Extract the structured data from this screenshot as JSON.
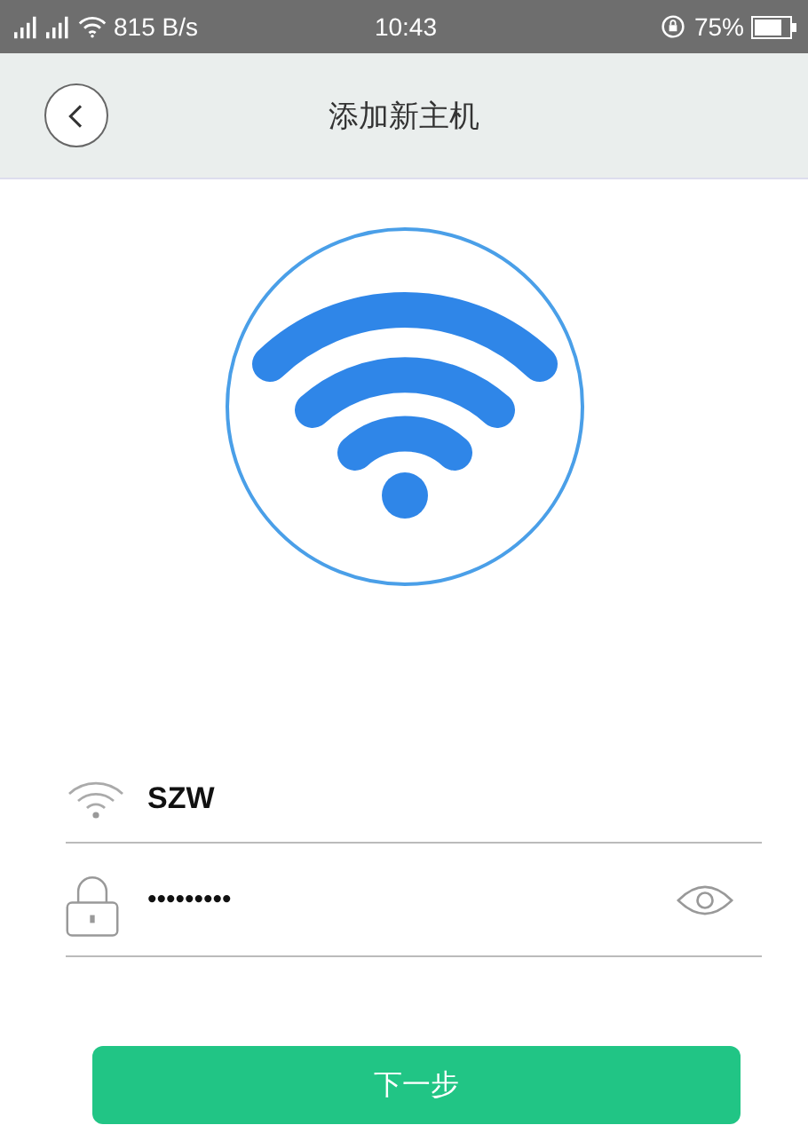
{
  "status_bar": {
    "speed": "815 B/s",
    "time": "10:43",
    "battery": "75%"
  },
  "header": {
    "title": "添加新主机"
  },
  "form": {
    "ssid": {
      "value": "SZW"
    },
    "password": {
      "value": "•••••••••"
    }
  },
  "buttons": [
    {
      "label": "下一步"
    }
  ]
}
